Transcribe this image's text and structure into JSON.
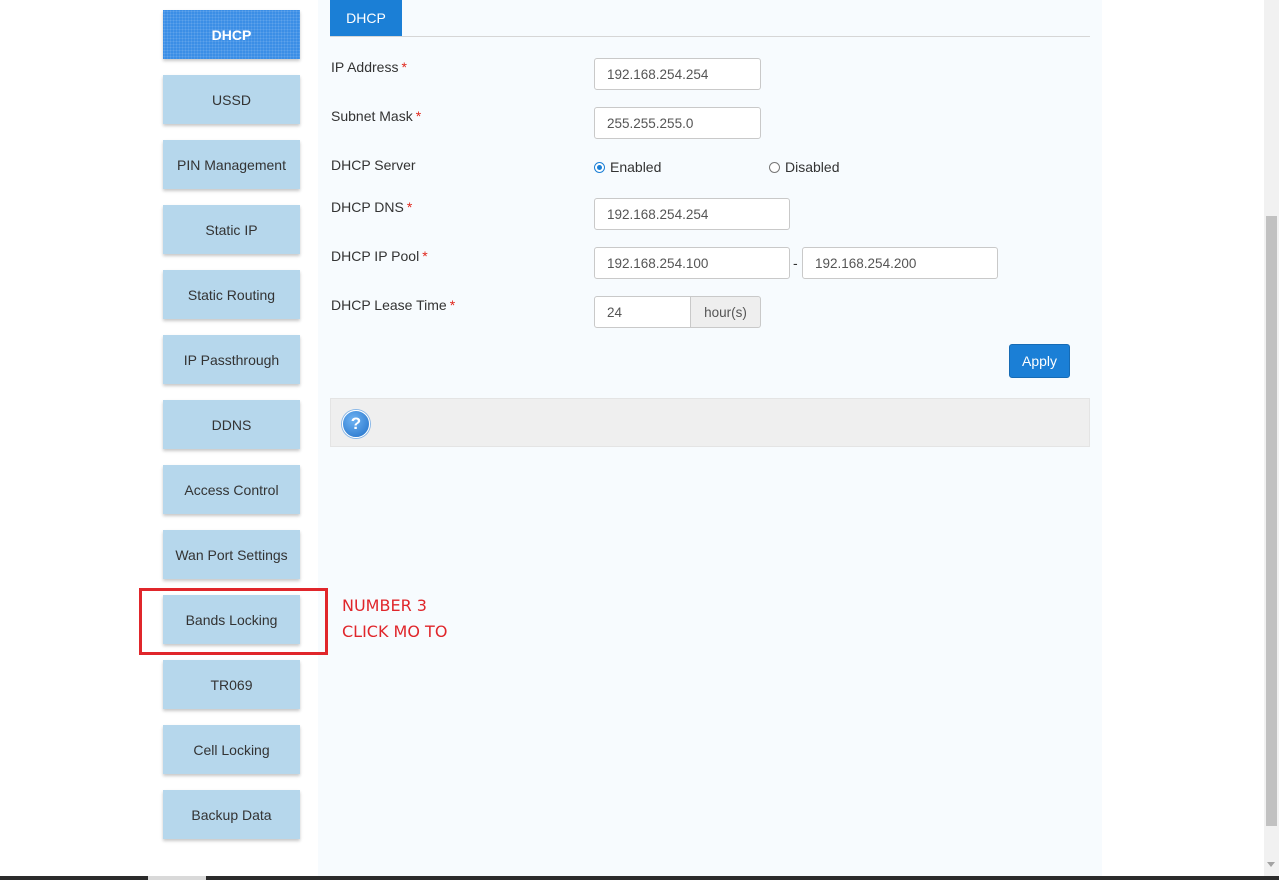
{
  "sidebar": {
    "items": [
      {
        "label": "DHCP",
        "active": true
      },
      {
        "label": "USSD"
      },
      {
        "label": "PIN Management"
      },
      {
        "label": "Static IP"
      },
      {
        "label": "Static Routing"
      },
      {
        "label": "IP Passthrough"
      },
      {
        "label": "DDNS"
      },
      {
        "label": "Access Control"
      },
      {
        "label": "Wan Port Settings"
      },
      {
        "label": "Bands Locking"
      },
      {
        "label": "TR069"
      },
      {
        "label": "Cell Locking"
      },
      {
        "label": "Backup Data"
      }
    ]
  },
  "tabs": [
    {
      "label": "DHCP",
      "active": true
    }
  ],
  "form": {
    "ip_address": {
      "label": "IP Address",
      "value": "192.168.254.254"
    },
    "subnet_mask": {
      "label": "Subnet Mask",
      "value": "255.255.255.0"
    },
    "dhcp_server": {
      "label": "DHCP Server",
      "enabled_label": "Enabled",
      "disabled_label": "Disabled",
      "selected": "Enabled"
    },
    "dhcp_dns": {
      "label": "DHCP DNS",
      "value": "192.168.254.254"
    },
    "dhcp_ip_pool": {
      "label": "DHCP IP Pool",
      "start": "192.168.254.100",
      "separator": "-",
      "end": "192.168.254.200"
    },
    "dhcp_lease_time": {
      "label": "DHCP Lease Time",
      "value": "24",
      "unit": "hour(s)"
    },
    "required_marker": "*",
    "apply_label": "Apply"
  },
  "help": {
    "icon": "question-icon",
    "glyph": "?"
  },
  "annotation": {
    "line1": "NUMBER 3",
    "line2": "CLICK MO TO",
    "color": "#e0262b"
  },
  "colors": {
    "accent": "#1b7fd6",
    "sidebar_button": "#b6d7ec",
    "required": "#e0261b"
  }
}
